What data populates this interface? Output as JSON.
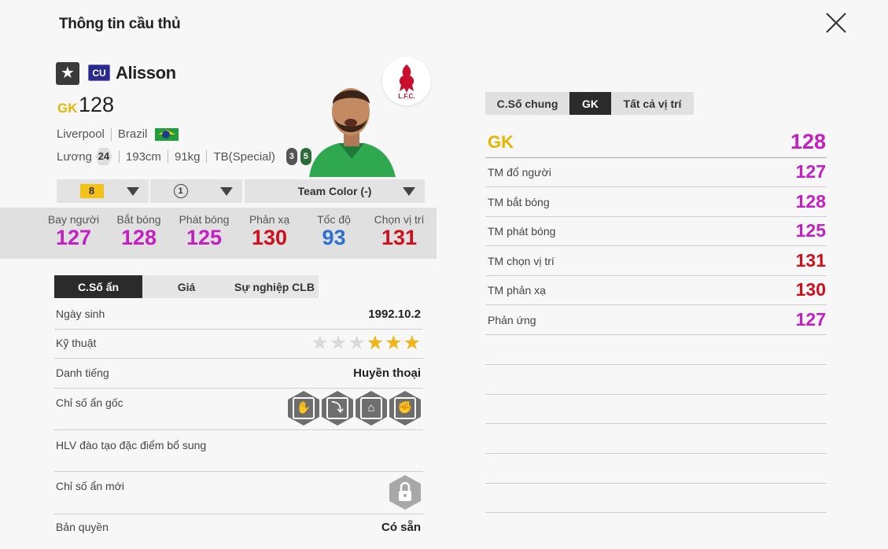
{
  "header": {
    "title": "Thông tin cầu thủ"
  },
  "player": {
    "season_badge": "CU",
    "name": "Alisson",
    "position": "GK",
    "ovr": "128",
    "club": "Liverpool",
    "nation": "Brazil",
    "salary_label": "Lương",
    "salary": "24",
    "height": "193cm",
    "weight": "91kg",
    "body_type": "TB(Special)",
    "foot_left": "3",
    "foot_right": "5",
    "club_logo_text": "L.F.C."
  },
  "selectors": {
    "level": "8",
    "rank": "1",
    "team_color": "Team Color (-)"
  },
  "main_stats": [
    {
      "label": "Bay người",
      "value": "127",
      "color": "#c41fc4"
    },
    {
      "label": "Bắt bóng",
      "value": "128",
      "color": "#c41fc4"
    },
    {
      "label": "Phát bóng",
      "value": "125",
      "color": "#c41fc4"
    },
    {
      "label": "Phản xạ",
      "value": "130",
      "color": "#d0101c"
    },
    {
      "label": "Tốc độ",
      "value": "93",
      "color": "#2a6fd1"
    },
    {
      "label": "Chọn vị trí",
      "value": "131",
      "color": "#d0101c"
    }
  ],
  "left_tabs": [
    "C.Số ẩn",
    "Giá",
    "Sự nghiệp CLB"
  ],
  "hidden": {
    "birthday_label": "Ngày sinh",
    "birthday": "1992.10.2",
    "skill_label": "Kỹ thuật",
    "skill_stars": 3,
    "skill_max": 6,
    "reputation_label": "Danh tiếng",
    "reputation": "Huyền thoại",
    "traits_label": "Chỉ số ẩn gốc",
    "trait_icons": [
      "glove-icon",
      "diving-keeper-icon",
      "goal-icon",
      "punch-icon"
    ],
    "coach_label": "HLV đào tạo đặc điểm bổ sung",
    "new_traits_label": "Chỉ số ẩn mới",
    "license_label": "Bản quyền",
    "license": "Có sẵn"
  },
  "right_tabs": [
    "C.Số chung",
    "GK",
    "Tất cả vị trí"
  ],
  "right_stats": {
    "head": {
      "label": "GK",
      "value": "128",
      "color": "#c41fc4"
    },
    "rows": [
      {
        "label": "TM đổ người",
        "value": "127",
        "color": "#c41fc4"
      },
      {
        "label": "TM bắt bóng",
        "value": "128",
        "color": "#c41fc4"
      },
      {
        "label": "TM phát bóng",
        "value": "125",
        "color": "#c41fc4"
      },
      {
        "label": "TM chọn vị trí",
        "value": "131",
        "color": "#d0101c"
      },
      {
        "label": "TM phản xạ",
        "value": "130",
        "color": "#d0101c"
      },
      {
        "label": "Phản ứng",
        "value": "127",
        "color": "#c41fc4"
      }
    ]
  }
}
